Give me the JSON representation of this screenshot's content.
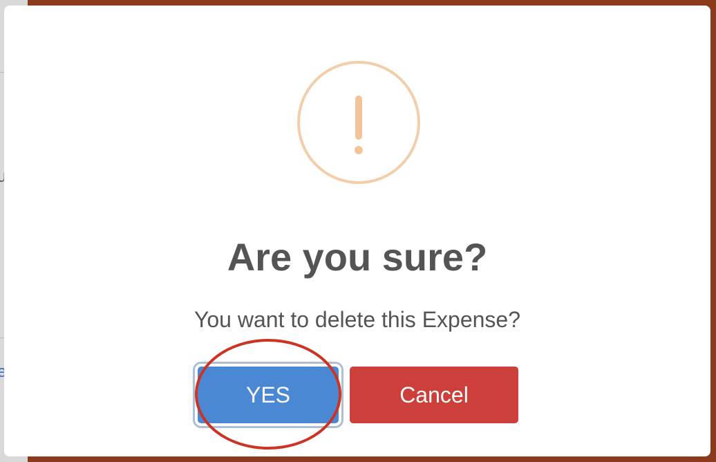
{
  "dialog": {
    "icon": "warning-exclamation-icon",
    "title": "Are you sure?",
    "message": "You want to delete this Expense?",
    "confirm_label": "YES",
    "cancel_label": "Cancel"
  },
  "colors": {
    "confirm_button": "#4a88d3",
    "cancel_button": "#cc3f3a",
    "warning_icon": "#f3ceab",
    "annotation": "#cc3322",
    "backdrop": "#8b3a1c"
  },
  "backdrop": {
    "glyph_top": "u",
    "glyph_bottom": "e"
  }
}
